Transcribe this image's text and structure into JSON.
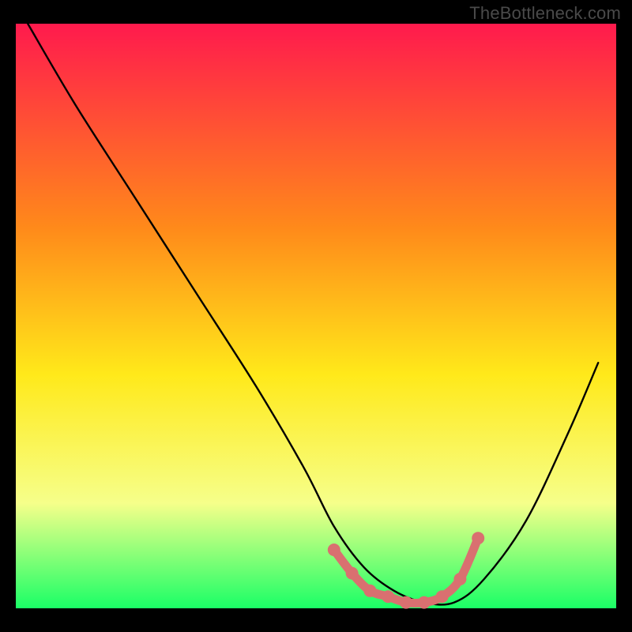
{
  "watermark": "TheBottleneck.com",
  "colors": {
    "gradient_top": "#ff1a4d",
    "gradient_mid1": "#ff8a1a",
    "gradient_mid2": "#ffe91a",
    "gradient_mid3": "#f6ff8a",
    "gradient_bottom": "#1aff66",
    "curve": "#000000",
    "overlay": "#d97070"
  },
  "chart_data": {
    "type": "line",
    "title": "",
    "xlabel": "",
    "ylabel": "",
    "xlim": [
      0,
      100
    ],
    "ylim": [
      0,
      100
    ],
    "series": [
      {
        "name": "bottleneck-curve",
        "x": [
          2,
          10,
          20,
          30,
          40,
          48,
          53,
          58,
          63,
          68,
          73,
          78,
          85,
          92,
          97
        ],
        "values": [
          100,
          86,
          70,
          54,
          38,
          24,
          14,
          7,
          3,
          1,
          1,
          5,
          15,
          30,
          42
        ]
      }
    ],
    "overlay_segment": {
      "name": "flat-highlight",
      "x": [
        53,
        56,
        59,
        62,
        65,
        68,
        71,
        74,
        77
      ],
      "values": [
        10,
        6,
        3,
        2,
        1,
        1,
        2,
        5,
        12
      ]
    }
  }
}
